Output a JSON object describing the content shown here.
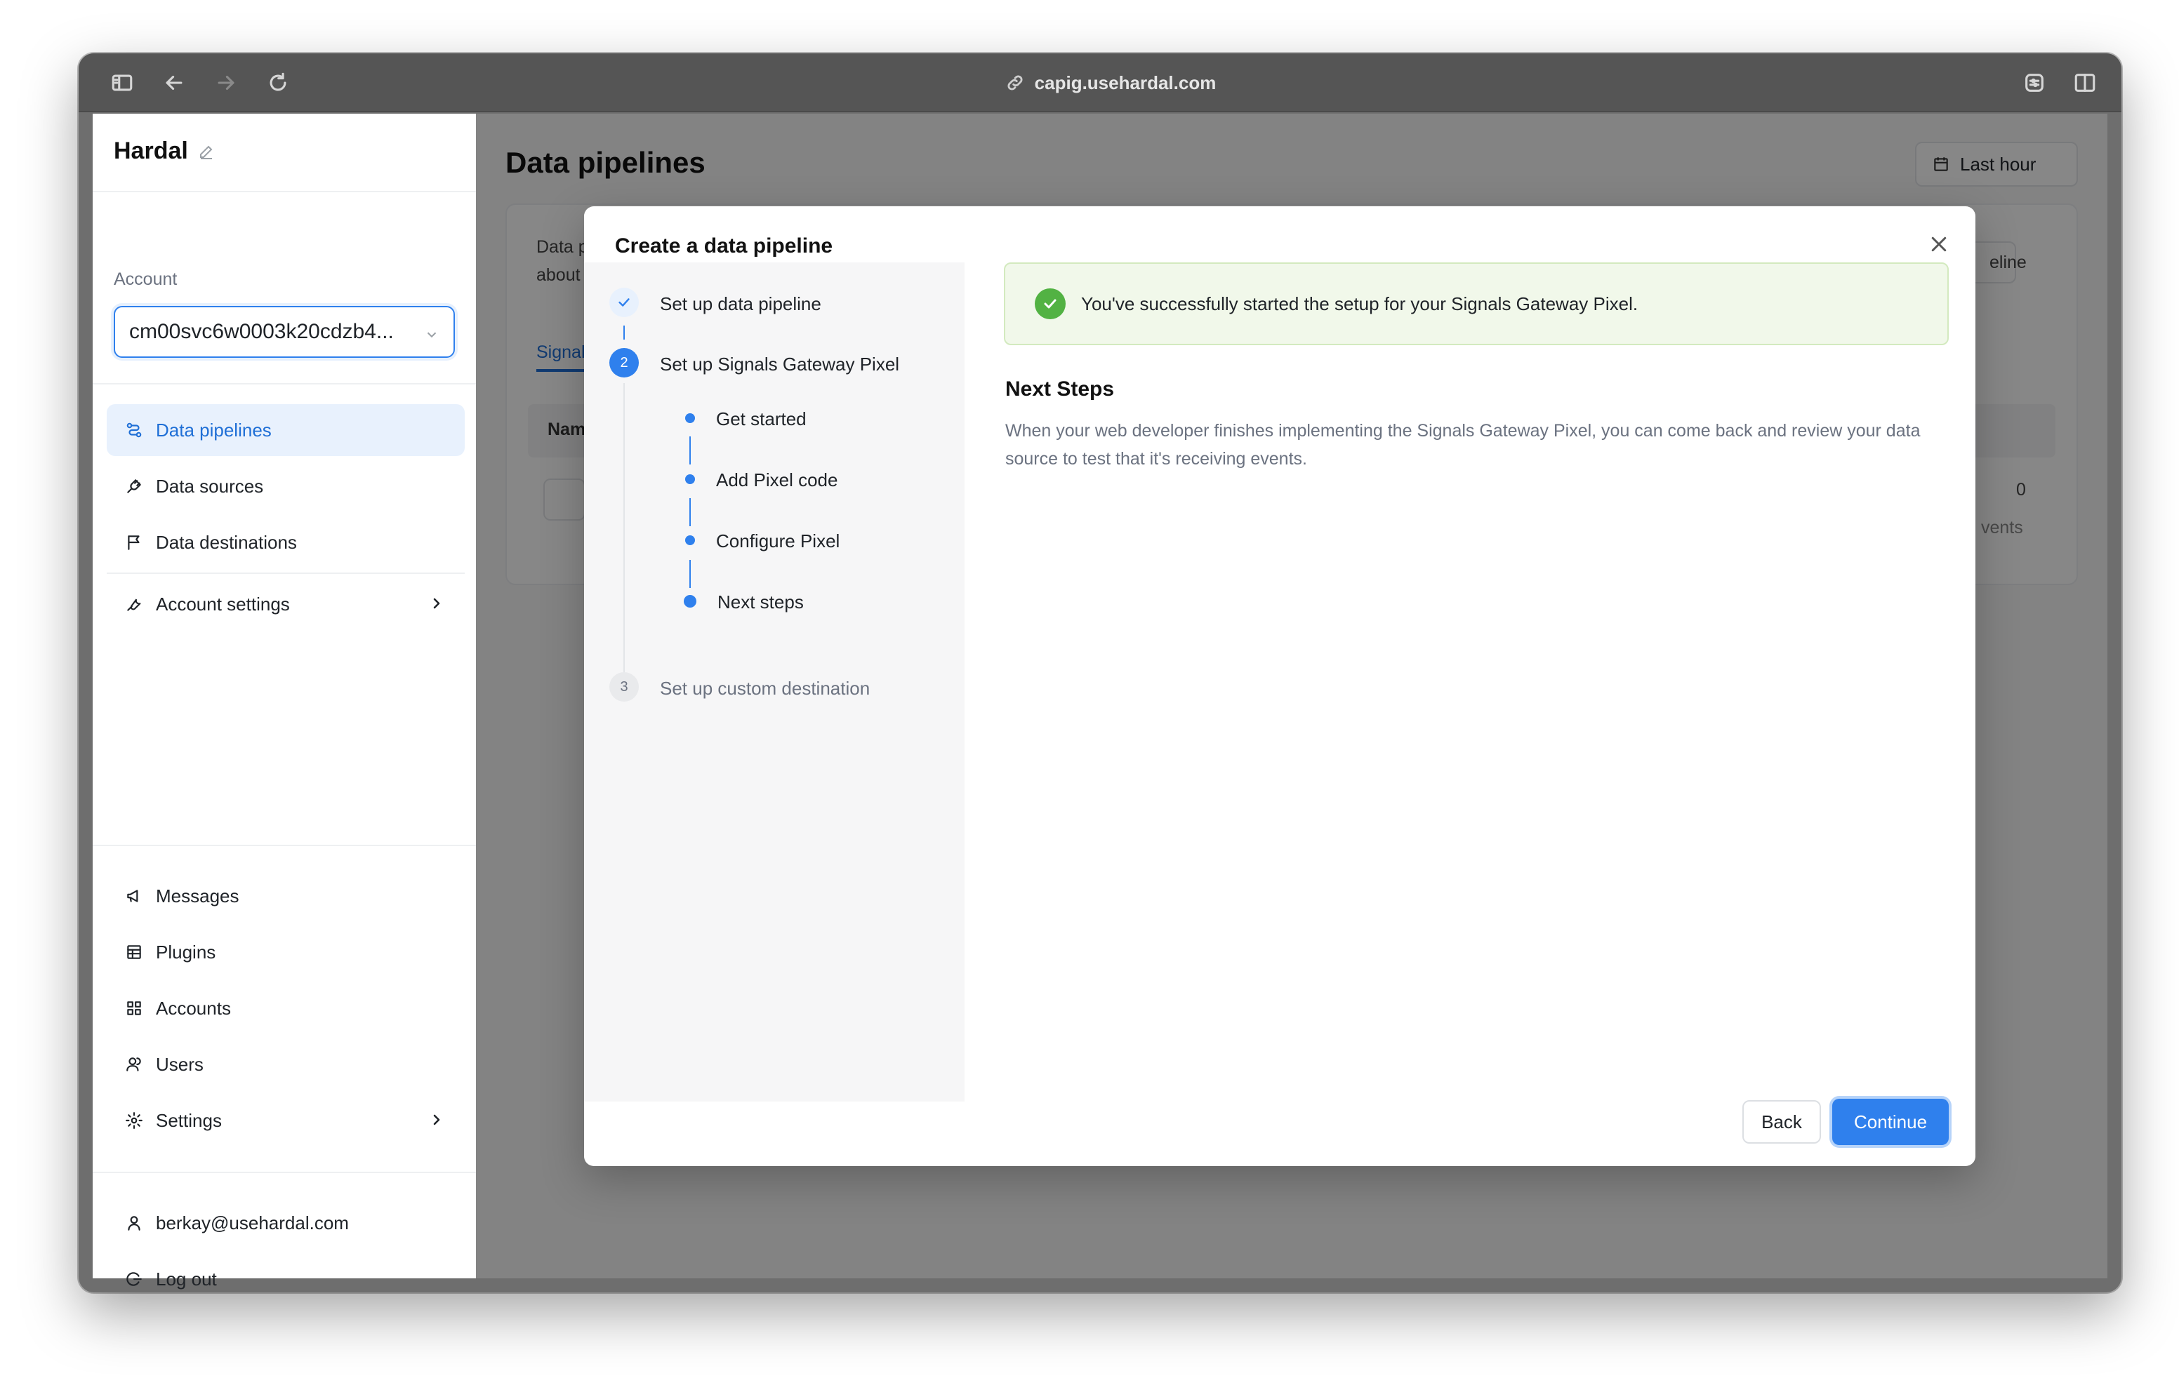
{
  "browser": {
    "url": "capig.usehardal.com",
    "icons": [
      "sidebar-toggle-icon",
      "back-icon",
      "forward-icon",
      "reload-icon",
      "extension-icon",
      "split-view-icon",
      "link-icon"
    ]
  },
  "sidebar": {
    "brand": "Hardal",
    "account_label": "Account",
    "account_value": "cm00svc6w0003k20cdzb4...",
    "nav_primary": [
      {
        "label": "Data pipelines",
        "icon": "pipeline-icon",
        "active": true
      },
      {
        "label": "Data sources",
        "icon": "plug-icon"
      },
      {
        "label": "Data destinations",
        "icon": "flag-icon"
      },
      {
        "label": "Account settings",
        "icon": "wrench-icon"
      }
    ],
    "nav_secondary": [
      {
        "label": "Messages",
        "icon": "megaphone-icon"
      },
      {
        "label": "Plugins",
        "icon": "plugin-icon"
      },
      {
        "label": "Accounts",
        "icon": "grid-icon"
      },
      {
        "label": "Users",
        "icon": "users-icon"
      },
      {
        "label": "Settings",
        "icon": "gear-icon"
      }
    ],
    "user_email": "berkay@usehardal.com",
    "logout": "Log out"
  },
  "main": {
    "title": "Data pipelines",
    "time_range": "Last hour",
    "bg_text_1": "Data p",
    "bg_text_2": "about",
    "bg_tab": "Signal",
    "bg_col": "Nam",
    "bg_btn": "eline",
    "bg_value": "0",
    "bg_sub": "vents"
  },
  "modal": {
    "title": "Create a data pipeline",
    "steps": [
      {
        "number": "1",
        "label": "Set up data pipeline",
        "state": "done"
      },
      {
        "number": "2",
        "label": "Set up Signals Gateway Pixel",
        "state": "current"
      },
      {
        "number": "3",
        "label": "Set up custom destination",
        "state": "pending"
      }
    ],
    "substeps": [
      "Get started",
      "Add Pixel code",
      "Configure Pixel",
      "Next steps"
    ],
    "success_message": "You've successfully started the setup for your Signals Gateway Pixel.",
    "next_steps_title": "Next Steps",
    "next_steps_body": "When your web developer finishes implementing the Signals Gateway Pixel, you can come back and review your data source to test that it's receiving events.",
    "back_label": "Back",
    "continue_label": "Continue"
  },
  "colors": {
    "accent": "#2f80ed",
    "success": "#52b243",
    "success_bg": "#f1f8ea"
  }
}
